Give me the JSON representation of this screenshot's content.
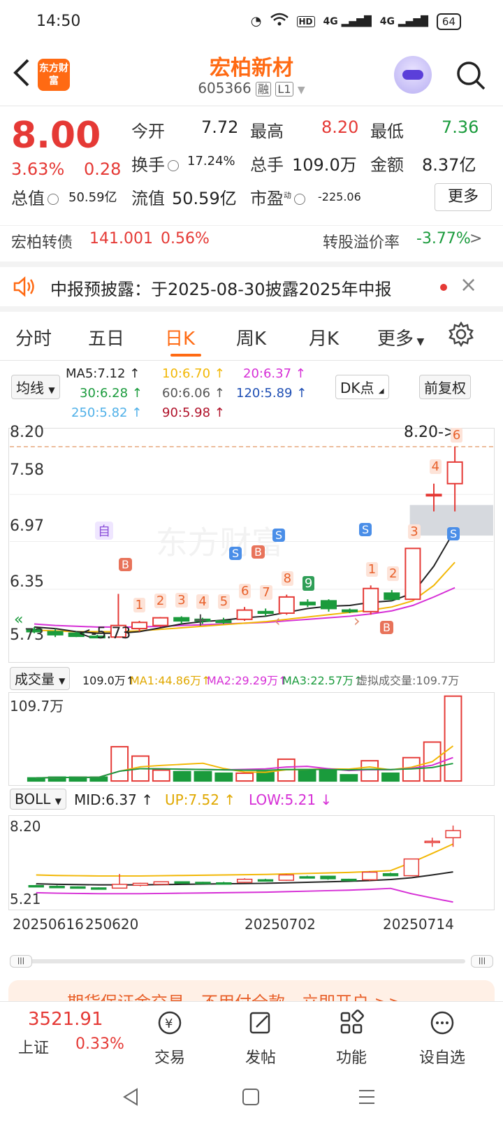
{
  "status": {
    "time": "14:50",
    "hd": "HD",
    "net1": "4G",
    "net2": "4G",
    "battery": "64"
  },
  "header": {
    "logo": "东方财富",
    "name": "宏柏新材",
    "code": "605366",
    "tag1": "融",
    "tag2": "L1"
  },
  "quote": {
    "price": "8.00",
    "pct": "3.63%",
    "change": "0.28",
    "open_label": "今开",
    "open": "7.72",
    "high_label": "最高",
    "high": "8.20",
    "low_label": "最低",
    "low": "7.36",
    "turnover_label": "换手",
    "turnover": "17.24%",
    "volume_label": "总手",
    "volume": "109.0万",
    "amount_label": "金额",
    "amount": "8.37亿",
    "mktcap_label": "总值",
    "mktcap": "50.59亿",
    "float_label": "流值",
    "float": "50.59亿",
    "pe_label": "市盈",
    "pe_sup": "动",
    "pe": "-225.06",
    "more": "更多"
  },
  "bond": {
    "name": "宏柏转债",
    "price": "141.001",
    "pct": "0.56%",
    "premium_label": "转股溢价率",
    "premium": "-3.77%",
    "arrow": ">"
  },
  "notice": {
    "text": "中报预披露：于2025-08-30披露2025年中报",
    "close": "×"
  },
  "tabs": [
    "分时",
    "五日",
    "日K",
    "周K",
    "月K",
    "更多"
  ],
  "legend": {
    "ma_select": "均线",
    "ma5": "MA5:7.12",
    "ma10": "10:6.70",
    "ma20": "20:6.37",
    "ma30": "30:6.28",
    "ma60": "60:6.06",
    "ma120": "120:5.89",
    "ma250": "250:5.82",
    "ma90": "90:5.98",
    "dk": "DK点",
    "fq": "前复权",
    "up_arrow": "↑"
  },
  "colors": {
    "up": "#e53935",
    "down": "#1a9b3c",
    "ma5": "#222222",
    "ma10": "#f2b705",
    "ma20": "#d62fd6",
    "ma30": "#1a9b3c",
    "ma60": "#555555",
    "ma120": "#1f4fb4",
    "ma250": "#4fb0e8",
    "ma90": "#b0122a"
  },
  "chart": {
    "ylabels": [
      "8.20",
      "7.58",
      "6.97",
      "6.35",
      "5.73"
    ],
    "high_label": "8.20->",
    "low_label": "<-5.73",
    "watermark": "东方财富",
    "self_tag": "自",
    "counts": [
      "1",
      "2",
      "3",
      "4",
      "5",
      "6",
      "7",
      "8",
      "9",
      "1",
      "2",
      "3",
      "4",
      "5",
      "6"
    ],
    "buy": "B",
    "sell": "S"
  },
  "chart_data": {
    "type": "candlestick",
    "ylim": [
      5.73,
      8.2
    ],
    "candles": [
      {
        "o": 5.83,
        "c": 5.8,
        "h": 5.86,
        "l": 5.78
      },
      {
        "o": 5.8,
        "c": 5.76,
        "h": 5.84,
        "l": 5.73
      },
      {
        "o": 5.78,
        "c": 5.74,
        "h": 5.8,
        "l": 5.73
      },
      {
        "o": 5.74,
        "c": 5.73,
        "h": 5.76,
        "l": 5.73
      },
      {
        "o": 5.73,
        "c": 5.88,
        "h": 6.29,
        "l": 5.73
      },
      {
        "o": 5.84,
        "c": 5.92,
        "h": 5.94,
        "l": 5.8
      },
      {
        "o": 5.88,
        "c": 5.98,
        "h": 5.99,
        "l": 5.86
      },
      {
        "o": 5.98,
        "c": 5.94,
        "h": 6.0,
        "l": 5.9
      },
      {
        "o": 5.96,
        "c": 5.94,
        "h": 5.98,
        "l": 5.9
      },
      {
        "o": 5.94,
        "c": 5.92,
        "h": 5.98,
        "l": 5.9
      },
      {
        "o": 5.96,
        "c": 6.08,
        "h": 6.12,
        "l": 5.94
      },
      {
        "o": 6.06,
        "c": 6.04,
        "h": 6.1,
        "l": 6.0
      },
      {
        "o": 6.04,
        "c": 6.25,
        "h": 6.28,
        "l": 6.02
      },
      {
        "o": 6.18,
        "c": 6.15,
        "h": 6.22,
        "l": 6.12
      },
      {
        "o": 6.2,
        "c": 6.1,
        "h": 6.22,
        "l": 6.06
      },
      {
        "o": 6.08,
        "c": 6.06,
        "h": 6.1,
        "l": 6.04
      },
      {
        "o": 6.06,
        "c": 6.36,
        "h": 6.4,
        "l": 6.02
      },
      {
        "o": 6.3,
        "c": 6.22,
        "h": 6.34,
        "l": 6.2
      },
      {
        "o": 6.22,
        "c": 6.88,
        "h": 6.88,
        "l": 6.22
      },
      {
        "o": 7.58,
        "c": 7.58,
        "h": 7.72,
        "l": 7.36
      },
      {
        "o": 7.72,
        "c": 8.0,
        "h": 8.2,
        "l": 7.36
      }
    ],
    "ma5": [
      5.86,
      5.84,
      5.8,
      5.78,
      5.78,
      5.8,
      5.85,
      5.9,
      5.93,
      5.95,
      5.98,
      6.0,
      6.05,
      6.1,
      6.13,
      6.14,
      6.18,
      6.2,
      6.3,
      6.65,
      7.12
    ],
    "ma10": [
      5.82,
      5.81,
      5.8,
      5.8,
      5.8,
      5.81,
      5.83,
      5.85,
      5.87,
      5.89,
      5.91,
      5.93,
      5.96,
      5.99,
      6.02,
      6.05,
      6.08,
      6.12,
      6.2,
      6.4,
      6.7
    ],
    "ma20": [
      5.9,
      5.88,
      5.87,
      5.86,
      5.86,
      5.86,
      5.87,
      5.88,
      5.89,
      5.9,
      5.91,
      5.92,
      5.94,
      5.96,
      5.98,
      6.0,
      6.03,
      6.07,
      6.14,
      6.25,
      6.37
    ]
  },
  "volume": {
    "select": "成交量",
    "vol": "109.0万",
    "ma1": "MA1:44.86万",
    "ma2": "MA2:29.29万",
    "ma3": "MA3:22.57万",
    "virtual": "虚拟成交量:109.7万",
    "ymax": "109.7万",
    "values": [
      4,
      5,
      5,
      5,
      44,
      32,
      14,
      12,
      12,
      10,
      10,
      12,
      28,
      14,
      14,
      8,
      26,
      10,
      30,
      50,
      109
    ]
  },
  "boll": {
    "select": "BOLL",
    "mid": "MID:6.37",
    "up": "UP:7.52",
    "low": "LOW:5.21",
    "ymax": "8.20",
    "ymin": "5.21"
  },
  "dates": {
    "d1": "20250616",
    "d2": "250620",
    "d3": "20250702",
    "d4": "20250714"
  },
  "promo": {
    "text": "期货保证金交易，不用付全款，立即开户 >>"
  },
  "bottom": {
    "index_value": "3521.91",
    "index_name": "上证",
    "index_pct": "0.33%",
    "trade": "交易",
    "post": "发帖",
    "func": "功能",
    "watch": "设自选"
  }
}
